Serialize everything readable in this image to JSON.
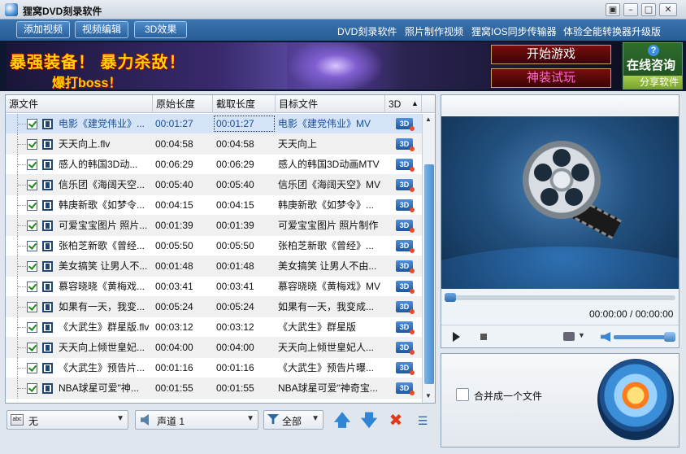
{
  "window": {
    "title": "狸窝DVD刻录软件",
    "controls": [
      "▣",
      "–",
      "□",
      "✕"
    ]
  },
  "toolbar": {
    "add_video": "添加视频",
    "edit_video": "视频编辑",
    "effect_3d": "3D效果",
    "links": [
      "DVD刻录软件",
      "照片制作视频",
      "狸窝IOS同步传输器",
      "体验全能转换器升级版"
    ]
  },
  "banner": {
    "headline": "暴强装备！ 暴力杀敌！",
    "sub": "爆打boss！",
    "btn_start": "开始游戏",
    "btn_trial": "神装试玩",
    "consult": "在线咨询",
    "share": "分享软件"
  },
  "table": {
    "columns": [
      "源文件",
      "原始长度",
      "截取长度",
      "目标文件",
      "3D"
    ],
    "rows": [
      [
        "电影《建党伟业》...",
        "00:01:27",
        "00:01:27",
        "电影《建党伟业》MV"
      ],
      [
        "天天向上.flv",
        "00:04:58",
        "00:04:58",
        "天天向上"
      ],
      [
        "感人的韩国3D动...",
        "00:06:29",
        "00:06:29",
        "感人的韩国3D动画MTV"
      ],
      [
        "信乐团《海阔天空...",
        "00:05:40",
        "00:05:40",
        "信乐团《海阔天空》MV"
      ],
      [
        "韩庚新歌《如梦令...",
        "00:04:15",
        "00:04:15",
        "韩庚新歌《如梦令》..."
      ],
      [
        "可爱宝宝图片 照片...",
        "00:01:39",
        "00:01:39",
        "可爱宝宝图片 照片制作"
      ],
      [
        "张柏芝新歌《曾经...",
        "00:05:50",
        "00:05:50",
        "张柏芝新歌《曾经》..."
      ],
      [
        "美女搞笑 让男人不...",
        "00:01:48",
        "00:01:48",
        "美女搞笑 让男人不由..."
      ],
      [
        "慕容晓晓《黄梅戏...",
        "00:03:41",
        "00:03:41",
        "慕容晓晓《黄梅戏》MV"
      ],
      [
        "如果有一天，我变...",
        "00:05:24",
        "00:05:24",
        "如果有一天，我变成..."
      ],
      [
        "《大武生》群星版.flv",
        "00:03:12",
        "00:03:12",
        "《大武生》群星版"
      ],
      [
        "天天向上倾世皇妃...",
        "00:04:00",
        "00:04:00",
        "天天向上倾世皇妃人..."
      ],
      [
        "《大武生》预告片...",
        "00:01:16",
        "00:01:16",
        "《大武生》预告片曝..."
      ],
      [
        "NBA球星可爱\"神...",
        "00:01:55",
        "00:01:55",
        "NBA球星可爱\"神奇宝..."
      ]
    ],
    "icon_3d": "3D"
  },
  "list_controls": {
    "subtitle": "无",
    "audio": "声道 1",
    "filter": "全部"
  },
  "player": {
    "time": "00:00:00 / 00:00:00"
  },
  "burn": {
    "merge_label": "合并成一个文件"
  }
}
